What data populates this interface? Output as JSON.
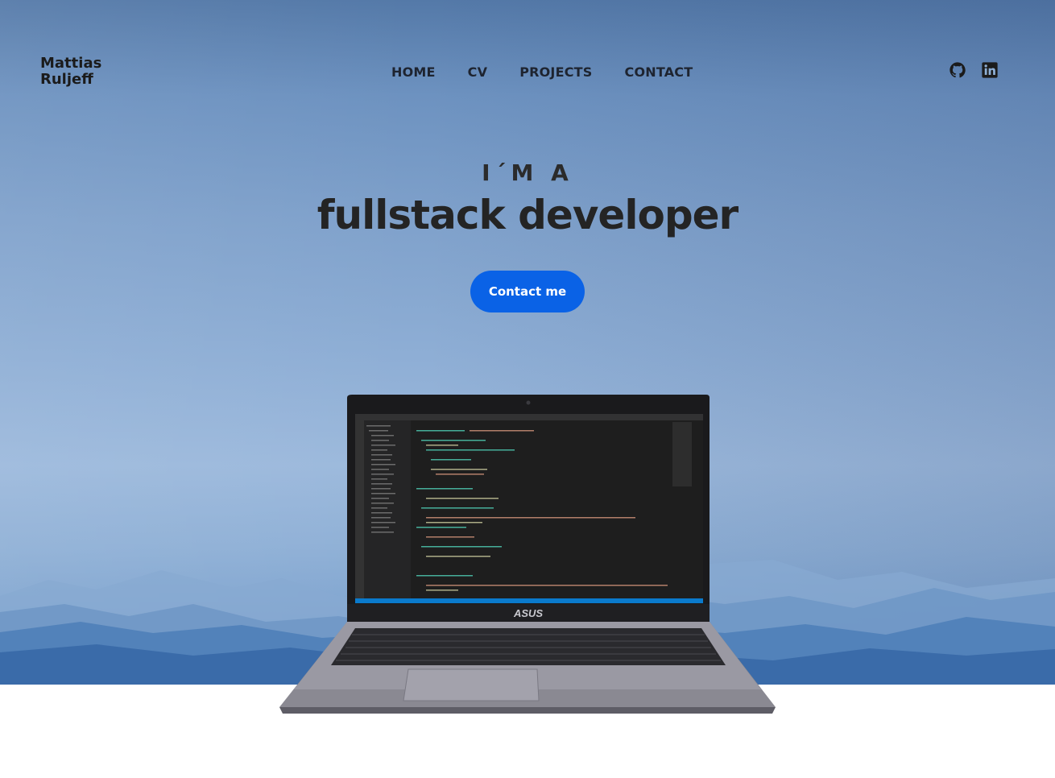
{
  "brand": {
    "name_line1": "Mattias",
    "name_line2": "Ruljeff"
  },
  "nav": {
    "items": [
      {
        "label": "HOME"
      },
      {
        "label": "CV"
      },
      {
        "label": "PROJECTS"
      },
      {
        "label": "CONTACT"
      }
    ]
  },
  "social": {
    "icons": [
      "github-icon",
      "linkedin-icon"
    ]
  },
  "hero": {
    "intro": "I´M A",
    "headline": "fullstack developer",
    "cta_label": "Contact me",
    "laptop_brand": "ASUS"
  },
  "colors": {
    "accent": "#0a62e6",
    "text_dark": "#1e2430",
    "sky_top": "#5479a8",
    "sky_mid": "#8eaed5"
  }
}
